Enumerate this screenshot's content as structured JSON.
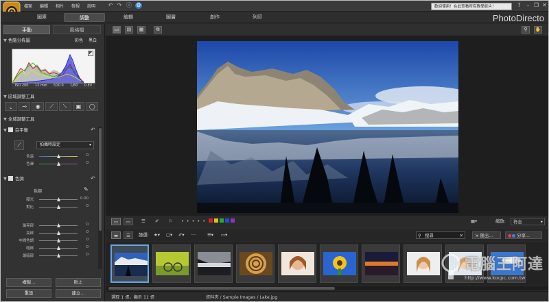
{
  "menu": {
    "file": "檔案",
    "edit": "編輯",
    "photo": "相片",
    "view": "檢視",
    "help": "說明"
  },
  "notification": "歡迎使用！在此查看所有教學影片！",
  "nav": {
    "library": "圖庫",
    "adjust": "調整",
    "editing": "編輯",
    "layers": "圖層",
    "create": "創作",
    "print": "列印"
  },
  "brand": "PhotoDirecto",
  "left": {
    "tab_manual": "手動",
    "tab_style": "風格檔",
    "histogram_title": "色階分佈圖",
    "color": "彩色",
    "bw": "黑白",
    "exif": [
      "ISO 200",
      "12 mm",
      "f/10.0",
      "1/60",
      "0 EV"
    ],
    "regional_title": "區域調整工具",
    "global_title": "全域調整工具",
    "wb_title": "白平衡",
    "wb_select": "拍攝時設定",
    "wb_rows": [
      {
        "label": "色溫",
        "value": "0"
      },
      {
        "label": "色澤",
        "value": "0"
      }
    ],
    "tone_title": "色調",
    "tone_label": "色調",
    "tone_rows": [
      {
        "label": "曝光",
        "value": "0.00"
      },
      {
        "label": "對比",
        "value": "0"
      }
    ],
    "tone_rows2": [
      {
        "label": "最亮部",
        "value": "0"
      },
      {
        "label": "亮部",
        "value": "0"
      },
      {
        "label": "中間色調",
        "value": "0"
      },
      {
        "label": "暗部",
        "value": "0"
      },
      {
        "label": "最暗部",
        "value": "0"
      }
    ],
    "copy": "複製...",
    "paste": "貼上",
    "reset": "重設",
    "create": "建立..."
  },
  "filmtools": {
    "zoom_label": "縮放:",
    "zoom_value": "符合",
    "filter": "篩選:",
    "search_placeholder": "搜尋",
    "export": "匯出...",
    "share": "分享..."
  },
  "status": {
    "selection": "選取 1 張，顯示 11 張",
    "path": "資料夾 / Sample Images / Lake.jpg"
  },
  "watermark": {
    "line1": "電腦王阿達",
    "line2": "http://www.kocpc.com.tw"
  },
  "colors": {
    "accent": "#4a90d9",
    "panel": "#323232",
    "frame": "#2b2b2b"
  },
  "thumbnails": [
    {
      "name": "lake",
      "selected": true
    },
    {
      "name": "bicycle",
      "selected": false
    },
    {
      "name": "shore",
      "selected": false
    },
    {
      "name": "spiral",
      "selected": false
    },
    {
      "name": "portrait",
      "selected": false
    },
    {
      "name": "sunflower",
      "selected": false
    },
    {
      "name": "sunset",
      "selected": false
    },
    {
      "name": "woman",
      "selected": false
    },
    {
      "name": "woman-2",
      "selected": false
    },
    {
      "name": "sky",
      "selected": false
    }
  ]
}
